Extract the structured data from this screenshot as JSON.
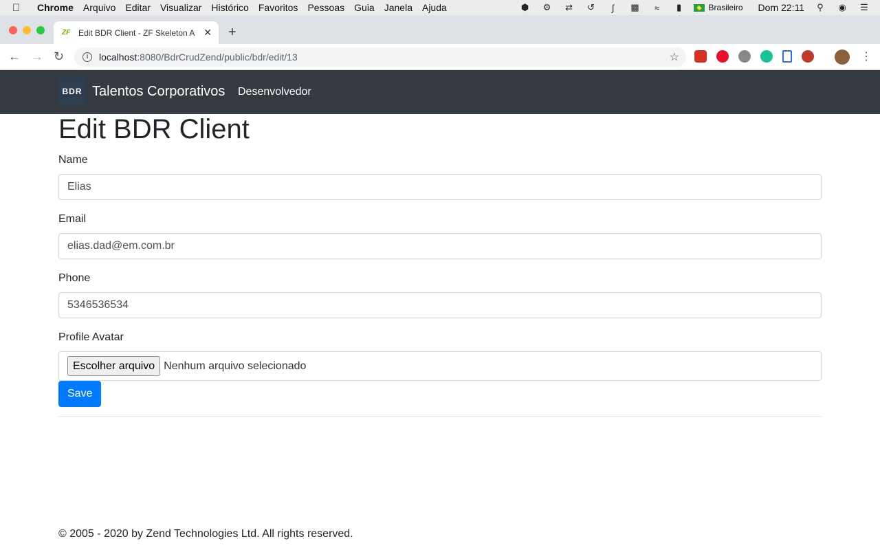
{
  "menubar": {
    "app": "Chrome",
    "items": [
      "Arquivo",
      "Editar",
      "Visualizar",
      "Histórico",
      "Favoritos",
      "Pessoas",
      "Guia",
      "Janela",
      "Ajuda"
    ],
    "language": "Brasileiro",
    "clock": "Dom 22:11"
  },
  "browser": {
    "tab_title": "Edit BDR Client - ZF Skeleton A",
    "tab_favicon": "ZF",
    "url_host": "localhost",
    "url_path": ":8080/BdrCrudZend/public/bdr/edit/13"
  },
  "navbar": {
    "logo_text": "BDR",
    "brand": "Talentos Corporativos",
    "link": "Desenvolvedor"
  },
  "page": {
    "title": "Edit BDR Client",
    "form": {
      "name_label": "Name",
      "name_value": "Elias",
      "email_label": "Email",
      "email_value": "elias.dad@em.com.br",
      "phone_label": "Phone",
      "phone_value": "5346536534",
      "avatar_label": "Profile Avatar",
      "file_button": "Escolher arquivo",
      "file_status": "Nenhum arquivo selecionado",
      "save_label": "Save"
    },
    "footer": "© 2005 - 2020 by Zend Technologies Ltd. All rights reserved."
  },
  "colors": {
    "navbar_bg": "#343a40",
    "primary": "#007bff"
  }
}
